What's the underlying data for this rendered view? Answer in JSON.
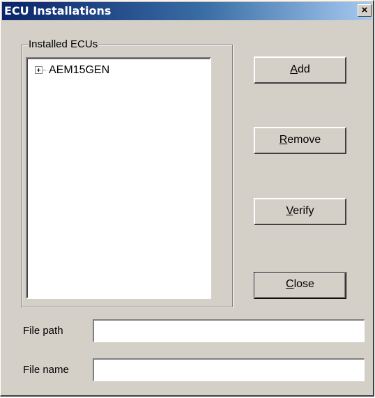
{
  "window": {
    "title": "ECU Installations",
    "close_glyph": "×"
  },
  "group": {
    "label": "Installed ECUs",
    "tree": {
      "items": [
        {
          "label": "AEM15GEN",
          "expanded": false
        }
      ]
    }
  },
  "buttons": {
    "add": {
      "mnemonic": "A",
      "rest": "dd"
    },
    "remove": {
      "mnemonic": "R",
      "rest": "emove"
    },
    "verify": {
      "mnemonic": "V",
      "rest": "erify"
    },
    "close": {
      "mnemonic": "C",
      "rest": "lose"
    }
  },
  "fields": {
    "file_path": {
      "label": "File path",
      "value": ""
    },
    "file_name": {
      "label": "File name",
      "value": ""
    }
  },
  "colors": {
    "face": "#d4d0c8",
    "title_start": "#0a246a",
    "title_end": "#a6caf0"
  }
}
